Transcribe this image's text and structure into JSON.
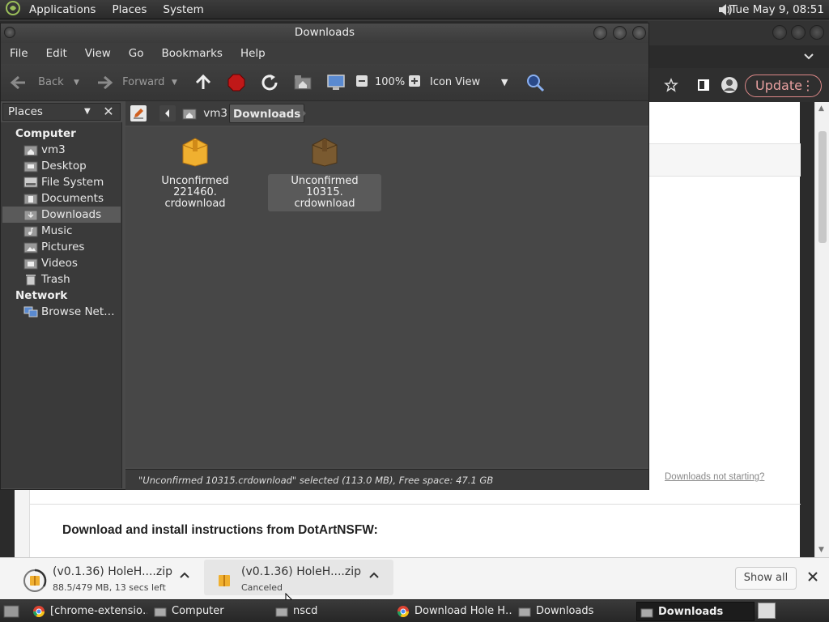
{
  "top_panel": {
    "menus": [
      "Applications",
      "Places",
      "System"
    ],
    "clock": "Tue May  9, 08:51"
  },
  "chrome": {
    "update_label": "Update",
    "page_link": "Downloads not starting?",
    "page_heading": "Download and install instructions from DotArtNSFW:"
  },
  "file_manager": {
    "title": "Downloads",
    "menu": [
      "File",
      "Edit",
      "View",
      "Go",
      "Bookmarks",
      "Help"
    ],
    "toolbar": {
      "back": "Back",
      "forward": "Forward",
      "zoom": "100%",
      "view_mode": "Icon View"
    },
    "sidebar": {
      "header": "Places",
      "section_computer": "Computer",
      "section_network": "Network",
      "computer_items": [
        "vm3",
        "Desktop",
        "File System",
        "Documents",
        "Downloads",
        "Music",
        "Pictures",
        "Videos",
        "Trash"
      ],
      "network_items": [
        "Browse Net…"
      ],
      "selected": "Downloads"
    },
    "path": [
      "vm3",
      "Downloads"
    ],
    "files": [
      {
        "line1": "Unconfirmed 221460.",
        "line2": "crdownload"
      },
      {
        "line1": "Unconfirmed 10315.",
        "line2": "crdownload"
      }
    ],
    "status": "\"Unconfirmed 10315.crdownload\" selected (113.0 MB), Free space: 47.1 GB"
  },
  "downloads_bar": {
    "items": [
      {
        "name": "(v0.1.36) HoleH....zip",
        "status": "88.5/479 MB, 13 secs left"
      },
      {
        "name": "(v0.1.36) HoleH....zip",
        "status": "Canceled"
      }
    ],
    "show_all": "Show all"
  },
  "taskbar": {
    "tasks": [
      "[chrome-extensio…",
      "Computer",
      "nscd",
      "Download Hole H…",
      "Downloads",
      "Downloads"
    ]
  },
  "colors": {
    "folder_orange": "#f0b030",
    "folder_brown": "#7a5a30",
    "selection_gray": "#5a5a5a"
  }
}
